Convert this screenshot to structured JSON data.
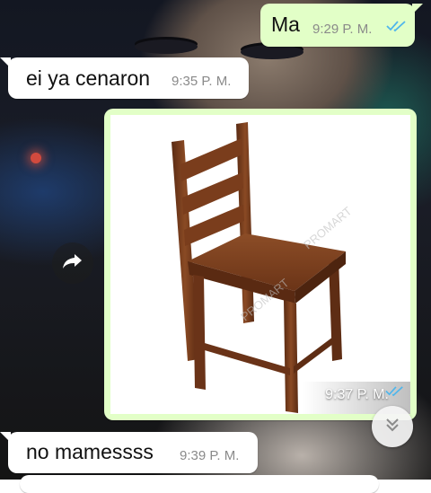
{
  "colors": {
    "outgoing_bubble": "#e2ffc7",
    "incoming_bubble": "#ffffff",
    "read_ticks": "#4fb6ec",
    "timestamp": "#8a8a8a"
  },
  "chat": {
    "messages": [
      {
        "direction": "outgoing",
        "text": "Ma",
        "time": "9:29 P. M.",
        "status": "read",
        "status_icon": "double-check-icon"
      },
      {
        "direction": "incoming",
        "text": "ei ya cenaron",
        "time": "9:35 P. M."
      },
      {
        "direction": "outgoing",
        "type": "image",
        "image_subject": "wooden-chair",
        "time": "9:37 P. M.",
        "status": "read",
        "status_icon": "double-check-icon"
      },
      {
        "direction": "incoming",
        "text": "no mamessss",
        "time": "9:39 P. M."
      }
    ],
    "forward_icon": "forward-arrow-icon",
    "scroll_down_icon": "double-chevron-down-icon"
  }
}
